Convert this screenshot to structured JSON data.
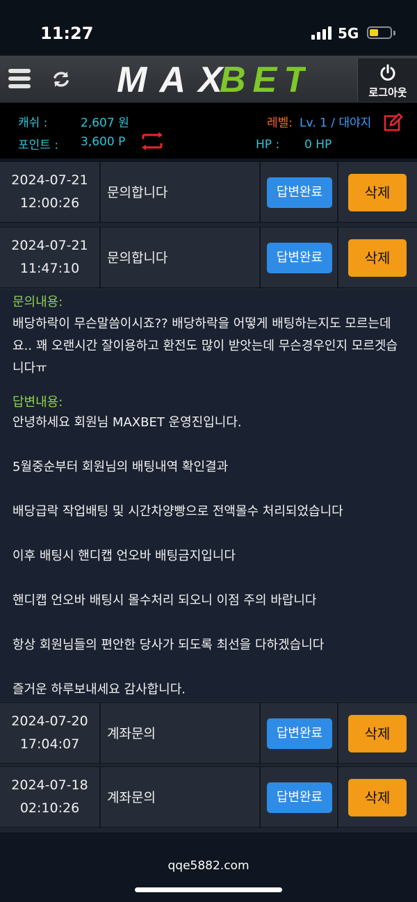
{
  "status_bar": {
    "time": "11:27",
    "network": "5G"
  },
  "header": {
    "logo_text": "MAXBET",
    "logout_label": "로그아웃"
  },
  "account": {
    "cash_label": "캐쉬 :",
    "cash_value": "2,607 원",
    "point_label": "포인트 :",
    "point_value": "3,600 P",
    "level_label": "레벨:",
    "level_value": "Lv. 1 / 대야지",
    "hp_label": "HP :",
    "hp_value": "0 HP"
  },
  "inquiries": [
    {
      "date": "2024-07-21",
      "time": "12:00:26",
      "title": "문의합니다",
      "status": "답변완료",
      "action": "삭제"
    },
    {
      "date": "2024-07-21",
      "time": "11:47:10",
      "title": "문의합니다",
      "status": "답변완료",
      "action": "삭제"
    },
    {
      "date": "2024-07-20",
      "time": "17:04:07",
      "title": "계좌문의",
      "status": "답변완료",
      "action": "삭제"
    },
    {
      "date": "2024-07-18",
      "time": "02:10:26",
      "title": "계좌문의",
      "status": "답변완료",
      "action": "삭제"
    }
  ],
  "detail": {
    "question_label": "문의내용:",
    "question_text": "배당하락이 무슨말씀이시죠?? 배당하락을 어떻게 배팅하는지도 모르는데요.. 꽤 오랜시간 잘이용하고 환전도 많이 받앗는데 무슨경우인지 모르겟습니다ㅠ",
    "answer_label": "답변내용:",
    "answer_lines": [
      "안녕하세요 회원님 MAXBET 운영진입니다.",
      "5월중순부터 회원님의 배팅내역 확인결과",
      "배당급락 작업배팅 및 시간차양빵으로 전액몰수 처리되었습니다",
      "이후 배팅시 핸디캡 언오바 배팅금지입니다",
      "핸디캡 언오바 배팅시 몰수처리 되오니 이점 주의 바랍니다",
      "항상 회원님들의 편안한 당사가 되도록 최선을 다하겠습니다",
      "즐거운 하루보내세요 감사합니다."
    ]
  },
  "footer": {
    "url": "qqe5882.com"
  },
  "colors": {
    "accent_cyan": "#2fc5d8",
    "accent_orange": "#ff6a1f",
    "status_blue": "#2f8ce6",
    "delete_orange": "#f39a16",
    "label_green": "#8fd14f"
  }
}
